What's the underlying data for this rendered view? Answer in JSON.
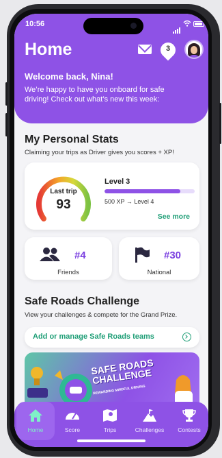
{
  "status_bar": {
    "time": "10:56"
  },
  "header": {
    "title": "Home",
    "notification_count": "3",
    "welcome_title": "Welcome back, Nina!",
    "welcome_text": "We’re happy to have you onboard for safe driving! Check out what’s new this week:"
  },
  "stats": {
    "title": "My Personal Stats",
    "subtitle": "Claiming your trips as Driver gives you scores + XP!",
    "last_trip_label": "Last trip",
    "last_trip_score": "93",
    "level": "Level 3",
    "xp_progress_percent": 84,
    "xp_text": "500 XP → Level 4",
    "see_more": "See more",
    "friends_rank": "#4",
    "friends_label": "Friends",
    "national_rank": "#30",
    "national_label": "National"
  },
  "challenge": {
    "title": "Safe Roads Challenge",
    "subtitle": "View your challenges & compete for the Grand Prize.",
    "teams_link": "Add or manage Safe Roads teams",
    "banner_title_line1": "SAFE ROADS",
    "banner_title_line2": "CHALLENGE",
    "banner_subtitle": "REWARDING MINDFUL DRIVING"
  },
  "tabs": [
    {
      "label": "Home",
      "icon": "home-icon",
      "active": true
    },
    {
      "label": "Score",
      "icon": "speedometer-icon",
      "active": false
    },
    {
      "label": "Trips",
      "icon": "map-icon",
      "active": false
    },
    {
      "label": "Challenges",
      "icon": "mountain-flag-icon",
      "active": false
    },
    {
      "label": "Contests",
      "icon": "trophy-icon",
      "active": false
    }
  ],
  "colors": {
    "brand_purple": "#8e52e6",
    "accent_green": "#1e9e76",
    "active_tab_label": "#7ff0c8"
  }
}
